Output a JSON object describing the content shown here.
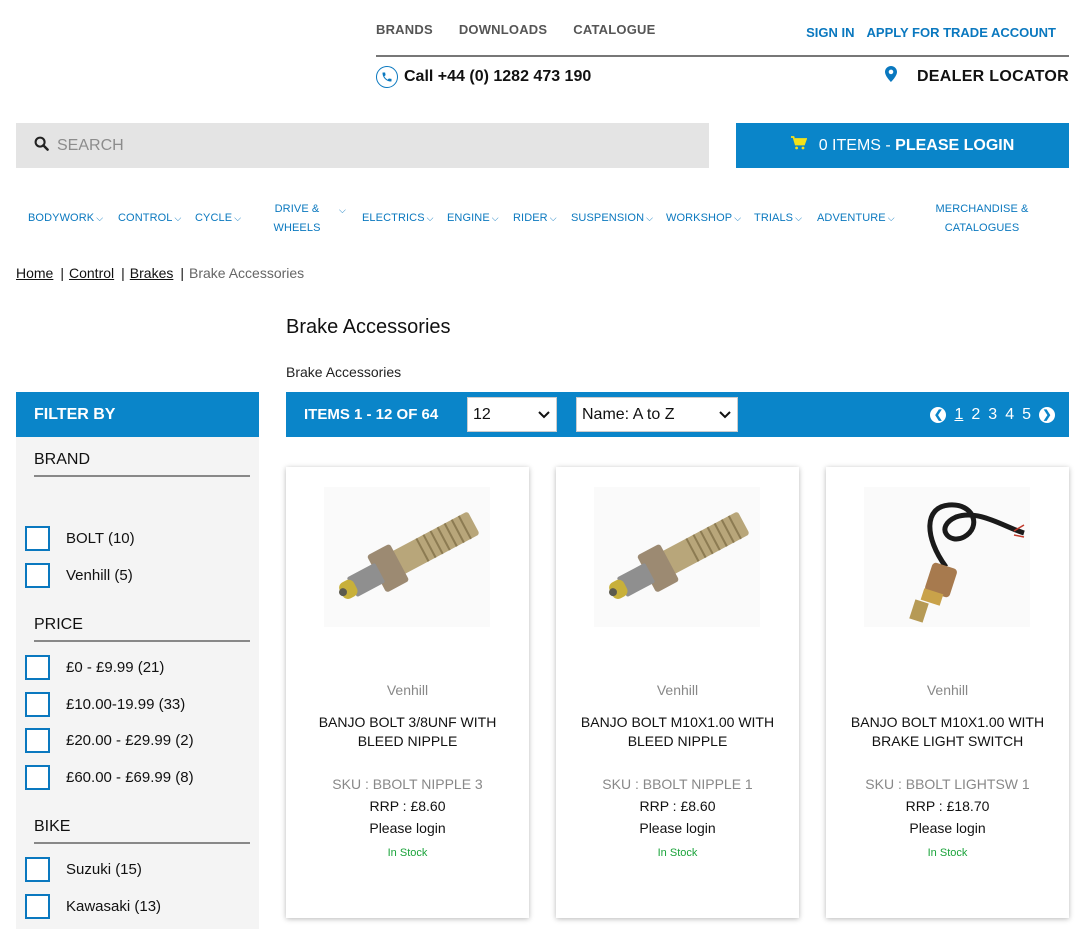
{
  "header": {
    "util_links": [
      "BRANDS",
      "DOWNLOADS",
      "CATALOGUE"
    ],
    "account_links": [
      "SIGN IN",
      "APPLY FOR TRADE ACCOUNT"
    ],
    "phone": "Call +44 (0) 1282 473 190",
    "dealer_locator": "DEALER LOCATOR"
  },
  "search": {
    "placeholder": "SEARCH"
  },
  "cart": {
    "prefix": "0 ITEMS - ",
    "action": "PLEASE LOGIN"
  },
  "nav": {
    "bodywork": "BODYWORK",
    "control": "CONTROL",
    "cycle": "CYCLE",
    "drive_1": "DRIVE &",
    "drive_2": "WHEELS",
    "electrics": "ELECTRICS",
    "engine": "ENGINE",
    "rider": "RIDER",
    "suspension": "SUSPENSION",
    "workshop": "WORKSHOP",
    "trials": "TRIALS",
    "adventure": "ADVENTURE",
    "merch_1": "MERCHANDISE &",
    "merch_2": "CATALOGUES"
  },
  "breadcrumb": {
    "home": "Home",
    "control": "Control",
    "brakes": "Brakes",
    "current": "Brake Accessories",
    "sep": "|"
  },
  "page": {
    "title": "Brake Accessories",
    "subtitle": "Brake Accessories"
  },
  "filter": {
    "heading": "FILTER BY",
    "brand_label": "BRAND",
    "brand_options": [
      "BOLT (10)",
      "Venhill (5)"
    ],
    "price_label": "PRICE",
    "price_options": [
      "£0 - £9.99 (21)",
      "£10.00-19.99 (33)",
      "£20.00 - £29.99 (2)",
      "£60.00 - £69.99 (8)"
    ],
    "bike_label": "BIKE",
    "bike_options": [
      "Suzuki (15)",
      "Kawasaki (13)"
    ]
  },
  "toolbar": {
    "count": "ITEMS 1 - 12 OF 64",
    "per_page": "12",
    "sort": "Name: A to Z",
    "pages": [
      "1",
      "2",
      "3",
      "4",
      "5"
    ],
    "current_page": "1"
  },
  "products": [
    {
      "brand": "Venhill",
      "name": "BANJO BOLT 3/8UNF WITH BLEED NIPPLE",
      "sku": "SKU : BBOLT NIPPLE 3",
      "rrp": "RRP : £8.60",
      "price_note": "Please login",
      "stock": "In Stock"
    },
    {
      "brand": "Venhill",
      "name": "BANJO BOLT M10X1.00 WITH BLEED NIPPLE",
      "sku": "SKU : BBOLT NIPPLE 1",
      "rrp": "RRP : £8.60",
      "price_note": "Please login",
      "stock": "In Stock"
    },
    {
      "brand": "Venhill",
      "name": "BANJO BOLT M10X1.00 WITH BRAKE LIGHT SWITCH",
      "sku": "SKU : BBOLT LIGHTSW 1",
      "rrp": "RRP : £18.70",
      "price_note": "Please login",
      "stock": "In Stock"
    }
  ],
  "colors": {
    "brand_blue": "#0a85c9",
    "link_blue": "#0a78bf",
    "stock_green": "#1aa33a"
  },
  "icons": [
    "phone-icon",
    "location-pin-icon",
    "search-icon",
    "cart-icon",
    "chevron-left-icon",
    "chevron-right-icon"
  ]
}
